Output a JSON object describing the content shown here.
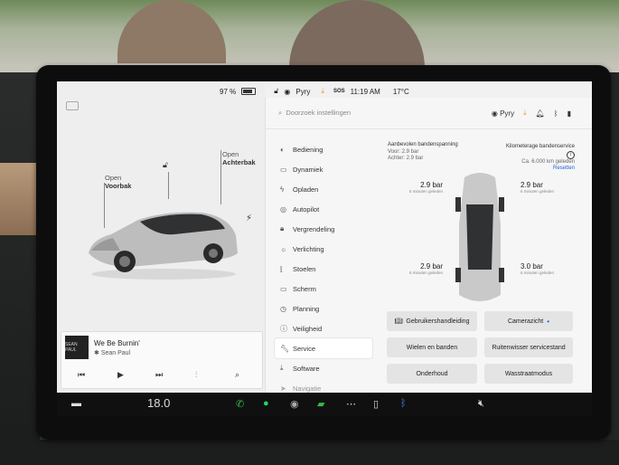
{
  "status_bar": {
    "battery": "97 %",
    "profile": "Pyry",
    "sos": "SOS",
    "time": "11:19 AM",
    "temperature": "17°C"
  },
  "car_panel": {
    "frunk_callout": {
      "action": "Open",
      "target": "Voorbak"
    },
    "trunk_callout": {
      "action": "Open",
      "target": "Achterbak"
    }
  },
  "media": {
    "song": "We Be Burnin'",
    "artist": "Sean Paul",
    "album_art_text": "SEAN PAUL"
  },
  "settings": {
    "search_placeholder": "Doorzoek instellingen",
    "profile": "Pyry",
    "menu": [
      {
        "label": "Bediening",
        "icon": "toggle-icon"
      },
      {
        "label": "Dynamiek",
        "icon": "car-icon"
      },
      {
        "label": "Opladen",
        "icon": "bolt-icon"
      },
      {
        "label": "Autopilot",
        "icon": "steering-wheel-icon"
      },
      {
        "label": "Vergrendeling",
        "icon": "lock-icon"
      },
      {
        "label": "Verlichting",
        "icon": "sun-icon"
      },
      {
        "label": "Stoelen",
        "icon": "seat-icon"
      },
      {
        "label": "Scherm",
        "icon": "screen-icon"
      },
      {
        "label": "Planning",
        "icon": "alarm-icon"
      },
      {
        "label": "Veiligheid",
        "icon": "info-icon"
      },
      {
        "label": "Service",
        "icon": "wrench-icon"
      },
      {
        "label": "Software",
        "icon": "download-icon"
      },
      {
        "label": "Navigatie",
        "icon": "navigation-icon"
      }
    ],
    "active_item": "Service",
    "tire": {
      "recommended_title": "Aanbevolen bandenspanning",
      "front": "Voor: 2.9 bar",
      "rear": "Achter: 2.9 bar",
      "service_title": "Kilometerage bandenservice",
      "service_sub": "Ca. 6.000 km geleden",
      "reset": "Resetten",
      "front_left": {
        "value": "2.9 bar",
        "ago": "6 minuten geleden"
      },
      "front_right": {
        "value": "2.9 bar",
        "ago": "6 minuten geleden"
      },
      "rear_left": {
        "value": "2.9 bar",
        "ago": "6 minuten geleden"
      },
      "rear_right": {
        "value": "3.0 bar",
        "ago": "6 minuten geleden"
      }
    },
    "buttons": {
      "manual": "Gebruikershandleiding",
      "camera": "Camerazicht",
      "wheels": "Wielen en banden",
      "wiper": "Ruitenwisser servicestand",
      "maintenance": "Onderhoud",
      "carwash": "Wasstraatmodus"
    }
  },
  "taskbar": {
    "climate_temp": "18.0"
  },
  "colors": {
    "accent": "#1d63d6",
    "download": "#e89b1a",
    "spotify": "#1ed760",
    "phone": "#3ab54a"
  }
}
